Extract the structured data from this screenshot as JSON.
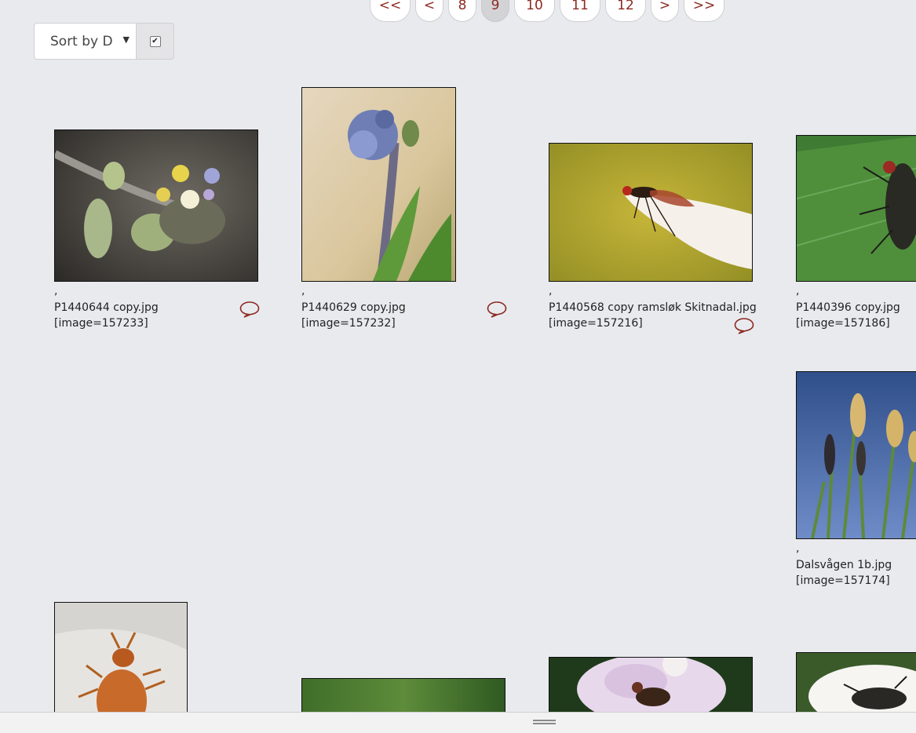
{
  "pagination": {
    "first": "<<",
    "prev": "<",
    "pages": [
      "8",
      "9",
      "10",
      "11",
      "12"
    ],
    "current": "9",
    "next": ">",
    "last": ">>"
  },
  "sort": {
    "selected": "Sort by D",
    "ascending_checked": true
  },
  "images": [
    {
      "prefix": ",",
      "filename": "P1440644 copy.jpg",
      "tag": "[image=157233]",
      "subject": "small-flowers",
      "has_comments": true
    },
    {
      "prefix": ",",
      "filename": "P1440629 copy.jpg",
      "tag": "[image=157232]",
      "subject": "blue-bud-flower",
      "has_comments": true
    },
    {
      "prefix": ",",
      "filename": "P1440568 copy ramsløk Skitnadal.jpg",
      "tag": "[image=157216]",
      "subject": "fly-on-petal",
      "has_comments": true
    },
    {
      "prefix": ",",
      "filename": "P1440396 copy.jpg",
      "tag": "[image=157186]",
      "subject": "fly-on-leaf",
      "has_comments": false
    },
    {
      "prefix": ",",
      "filename": "Dalsvågen 1b.jpg",
      "tag": "[image=157174]",
      "subject": "sedge-flowers",
      "has_comments": false
    },
    {
      "subject": "orange-beetle"
    },
    {
      "subject": "green-blur"
    },
    {
      "subject": "hoverfly-on-flower"
    },
    {
      "subject": "fly-on-white-flower"
    }
  ],
  "colors": {
    "accent": "#8b2a22",
    "background": "#e9eaee"
  }
}
